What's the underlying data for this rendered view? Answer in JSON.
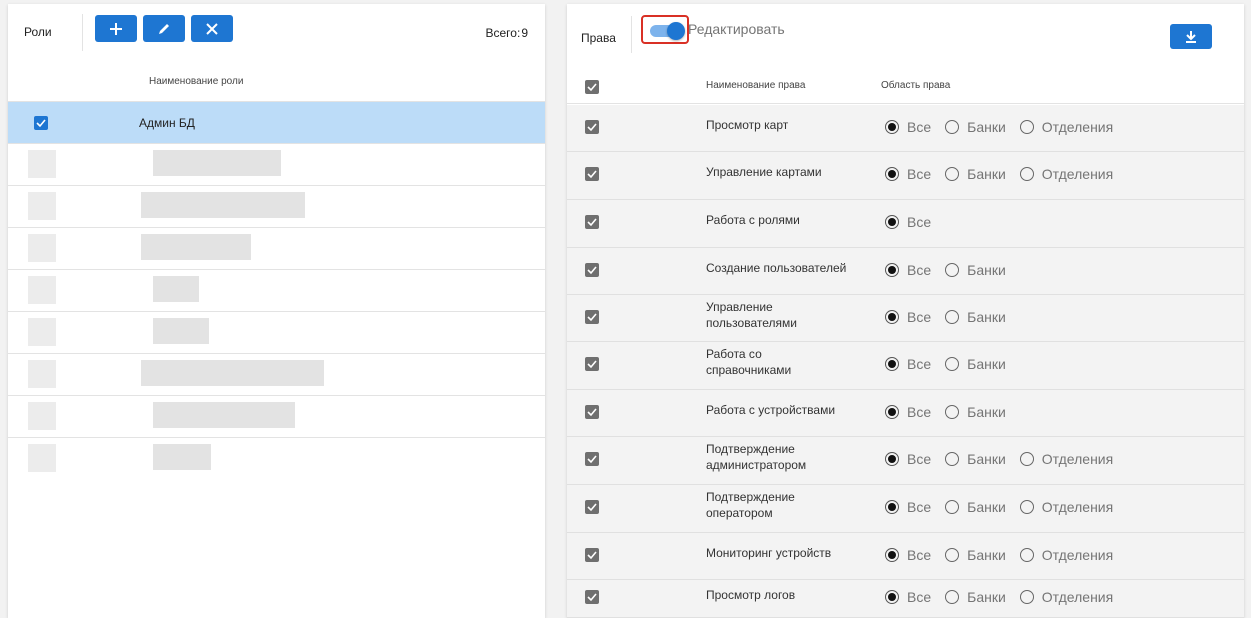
{
  "roles": {
    "title": "Роли",
    "total_label": "Всего:",
    "total_value": "9",
    "column_name": "Наименование роли",
    "selected_role": "Админ БД"
  },
  "rights": {
    "title": "Права",
    "edit_toggle_label": "Редактировать",
    "edit_toggle_on": true,
    "column_name": "Наименование права",
    "column_scope": "Область права",
    "scope_all": "Все",
    "scope_banks": "Банки",
    "scope_branches": "Отделения",
    "items": [
      {
        "name": "Просмотр карт",
        "scopes": 3
      },
      {
        "name": "Управление картами",
        "scopes": 3
      },
      {
        "name": "Работа с ролями",
        "scopes": 1
      },
      {
        "name": "Создание пользователей",
        "scopes": 2
      },
      {
        "name": "Управление пользователями",
        "scopes": 2
      },
      {
        "name": "Работа со справочниками",
        "scopes": 2
      },
      {
        "name": "Работа с устройствами",
        "scopes": 2
      },
      {
        "name": "Подтверждение администратором",
        "scopes": 3
      },
      {
        "name": "Подтверждение оператором",
        "scopes": 3
      },
      {
        "name": "Мониторинг устройств",
        "scopes": 3
      },
      {
        "name": "Просмотр логов",
        "scopes": 3
      }
    ]
  },
  "colors": {
    "accent": "#1e76d2",
    "selected_row": "#bcdcf8",
    "highlight_border": "#d93025"
  }
}
